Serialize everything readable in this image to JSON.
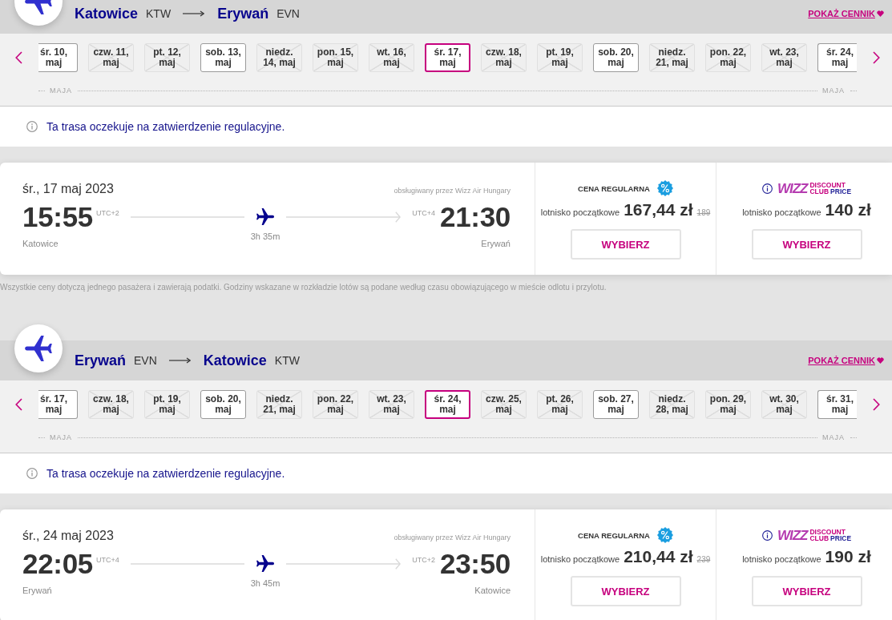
{
  "routes": [
    {
      "origin": {
        "city": "Katowice",
        "code": "KTW"
      },
      "destination": {
        "city": "Erywań",
        "code": "EVN"
      },
      "price_link": "POKAŻ CENNIK",
      "dates": [
        {
          "label": "śr. 10, maj",
          "available": true,
          "selected": false
        },
        {
          "label": "czw. 11, maj",
          "available": false,
          "selected": false
        },
        {
          "label": "pt. 12, maj",
          "available": false,
          "selected": false
        },
        {
          "label": "sob. 13, maj",
          "available": true,
          "selected": false
        },
        {
          "label": "niedz. 14, maj",
          "available": false,
          "selected": false
        },
        {
          "label": "pon. 15, maj",
          "available": false,
          "selected": false
        },
        {
          "label": "wt. 16, maj",
          "available": false,
          "selected": false
        },
        {
          "label": "śr. 17, maj",
          "available": true,
          "selected": true
        },
        {
          "label": "czw. 18, maj",
          "available": false,
          "selected": false
        },
        {
          "label": "pt. 19, maj",
          "available": false,
          "selected": false
        },
        {
          "label": "sob. 20, maj",
          "available": true,
          "selected": false
        },
        {
          "label": "niedz. 21, maj",
          "available": false,
          "selected": false
        },
        {
          "label": "pon. 22, maj",
          "available": false,
          "selected": false
        },
        {
          "label": "wt. 23, maj",
          "available": false,
          "selected": false
        },
        {
          "label": "śr. 24, maj",
          "available": true,
          "selected": false
        }
      ],
      "month_labels": [
        "MAJA",
        "MAJA"
      ],
      "notice": "Ta trasa oczekuje na zatwierdzenie regulacyjne.",
      "flight": {
        "date": "śr., 17 maj 2023",
        "operator": "obsługiwany przez Wizz Air Hungary",
        "departure": {
          "time": "15:55",
          "utc": "UTC+2",
          "city": "Katowice"
        },
        "arrival": {
          "time": "21:30",
          "utc": "UTC+4",
          "city": "Erywań"
        },
        "duration": "3h 35m"
      },
      "fares": [
        {
          "kind": "regular",
          "title": "CENA REGULARNA",
          "label": "lotnisko początkowe",
          "price": "167,44 zł",
          "old_price": "189",
          "button": "WYBIERZ"
        },
        {
          "kind": "club",
          "logo": {
            "mark": "WIZZ",
            "lines": [
              {
                "words": [
                  {
                    "text": "DISCOUNT",
                    "color": "#c6007e"
                  }
                ]
              },
              {
                "words": [
                  {
                    "text": "CLUB",
                    "color": "#c6007e"
                  },
                  {
                    "text": "PRICE",
                    "color": "#1e1e96"
                  }
                ]
              }
            ]
          },
          "label": "lotnisko początkowe",
          "price": "140 zł",
          "button": "WYBIERZ"
        }
      ],
      "footnote": "Wszystkie ceny dotyczą jednego pasażera i zawierają podatki. Godziny wskazane w rozkładzie lotów są podane według czasu obowiązującego w mieście odlotu i przylotu."
    },
    {
      "origin": {
        "city": "Erywań",
        "code": "EVN"
      },
      "destination": {
        "city": "Katowice",
        "code": "KTW"
      },
      "price_link": "POKAŻ CENNIK",
      "dates": [
        {
          "label": "śr. 17, maj",
          "available": true,
          "selected": false
        },
        {
          "label": "czw. 18, maj",
          "available": false,
          "selected": false
        },
        {
          "label": "pt. 19, maj",
          "available": false,
          "selected": false
        },
        {
          "label": "sob. 20, maj",
          "available": true,
          "selected": false
        },
        {
          "label": "niedz. 21, maj",
          "available": false,
          "selected": false
        },
        {
          "label": "pon. 22, maj",
          "available": false,
          "selected": false
        },
        {
          "label": "wt. 23, maj",
          "available": false,
          "selected": false
        },
        {
          "label": "śr. 24, maj",
          "available": true,
          "selected": true
        },
        {
          "label": "czw. 25, maj",
          "available": false,
          "selected": false
        },
        {
          "label": "pt. 26, maj",
          "available": false,
          "selected": false
        },
        {
          "label": "sob. 27, maj",
          "available": true,
          "selected": false
        },
        {
          "label": "niedz. 28, maj",
          "available": false,
          "selected": false
        },
        {
          "label": "pon. 29, maj",
          "available": false,
          "selected": false
        },
        {
          "label": "wt. 30, maj",
          "available": false,
          "selected": false
        },
        {
          "label": "śr. 31, maj",
          "available": true,
          "selected": false
        }
      ],
      "month_labels": [
        "MAJA",
        "MAJA"
      ],
      "notice": "Ta trasa oczekuje na zatwierdzenie regulacyjne.",
      "flight": {
        "date": "śr., 24 maj 2023",
        "operator": "obsługiwany przez Wizz Air Hungary",
        "departure": {
          "time": "22:05",
          "utc": "UTC+4",
          "city": "Erywań"
        },
        "arrival": {
          "time": "23:50",
          "utc": "UTC+2",
          "city": "Katowice"
        },
        "duration": "3h 45m"
      },
      "fares": [
        {
          "kind": "regular",
          "title": "CENA REGULARNA",
          "label": "lotnisko początkowe",
          "price": "210,44 zł",
          "old_price": "239",
          "button": "WYBIERZ"
        },
        {
          "kind": "club",
          "logo": {
            "mark": "WIZZ",
            "lines": [
              {
                "words": [
                  {
                    "text": "DISCOUNT",
                    "color": "#c6007e"
                  }
                ]
              },
              {
                "words": [
                  {
                    "text": "CLUB",
                    "color": "#c6007e"
                  },
                  {
                    "text": "PRICE",
                    "color": "#1e1e96"
                  }
                ]
              }
            ]
          },
          "label": "lotnisko początkowe",
          "price": "190 zł",
          "button": "WYBIERZ"
        }
      ]
    }
  ]
}
